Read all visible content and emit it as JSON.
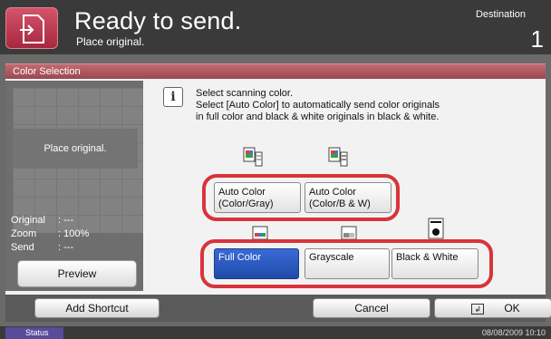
{
  "header": {
    "title": "Ready to send.",
    "subtitle": "Place original.",
    "destination_label": "Destination",
    "destination_count": "1",
    "home_icon": "document-send-icon"
  },
  "section": {
    "title": "Color Selection"
  },
  "preview": {
    "place_original": "Place original.",
    "info": [
      {
        "label": "Original",
        "value": ": ---"
      },
      {
        "label": "Zoom",
        "value": ": 100%"
      },
      {
        "label": "Send",
        "value": ": ---"
      }
    ],
    "button_label": "Preview"
  },
  "instruction": {
    "line1": "Select scanning color.",
    "line2": "Select [Auto Color] to automatically send color originals",
    "line3": "in full color and black & white originals in black & white."
  },
  "options": {
    "auto_color_gray": {
      "line1": "Auto Color",
      "line2": "(Color/Gray)"
    },
    "auto_color_bw": {
      "line1": "Auto Color",
      "line2": "(Color/B & W)"
    },
    "full_color": "Full Color",
    "grayscale": "Grayscale",
    "black_white": "Black & White",
    "selected": "full_color"
  },
  "footer": {
    "add_shortcut": "Add Shortcut",
    "cancel": "Cancel",
    "ok": "OK"
  },
  "status": {
    "label": "Status",
    "datetime": "08/08/2009  10:10"
  },
  "colors": {
    "selected": "#2a5bc4",
    "highlight_ring": "#d9333a",
    "header_accent": "#c0394f"
  }
}
